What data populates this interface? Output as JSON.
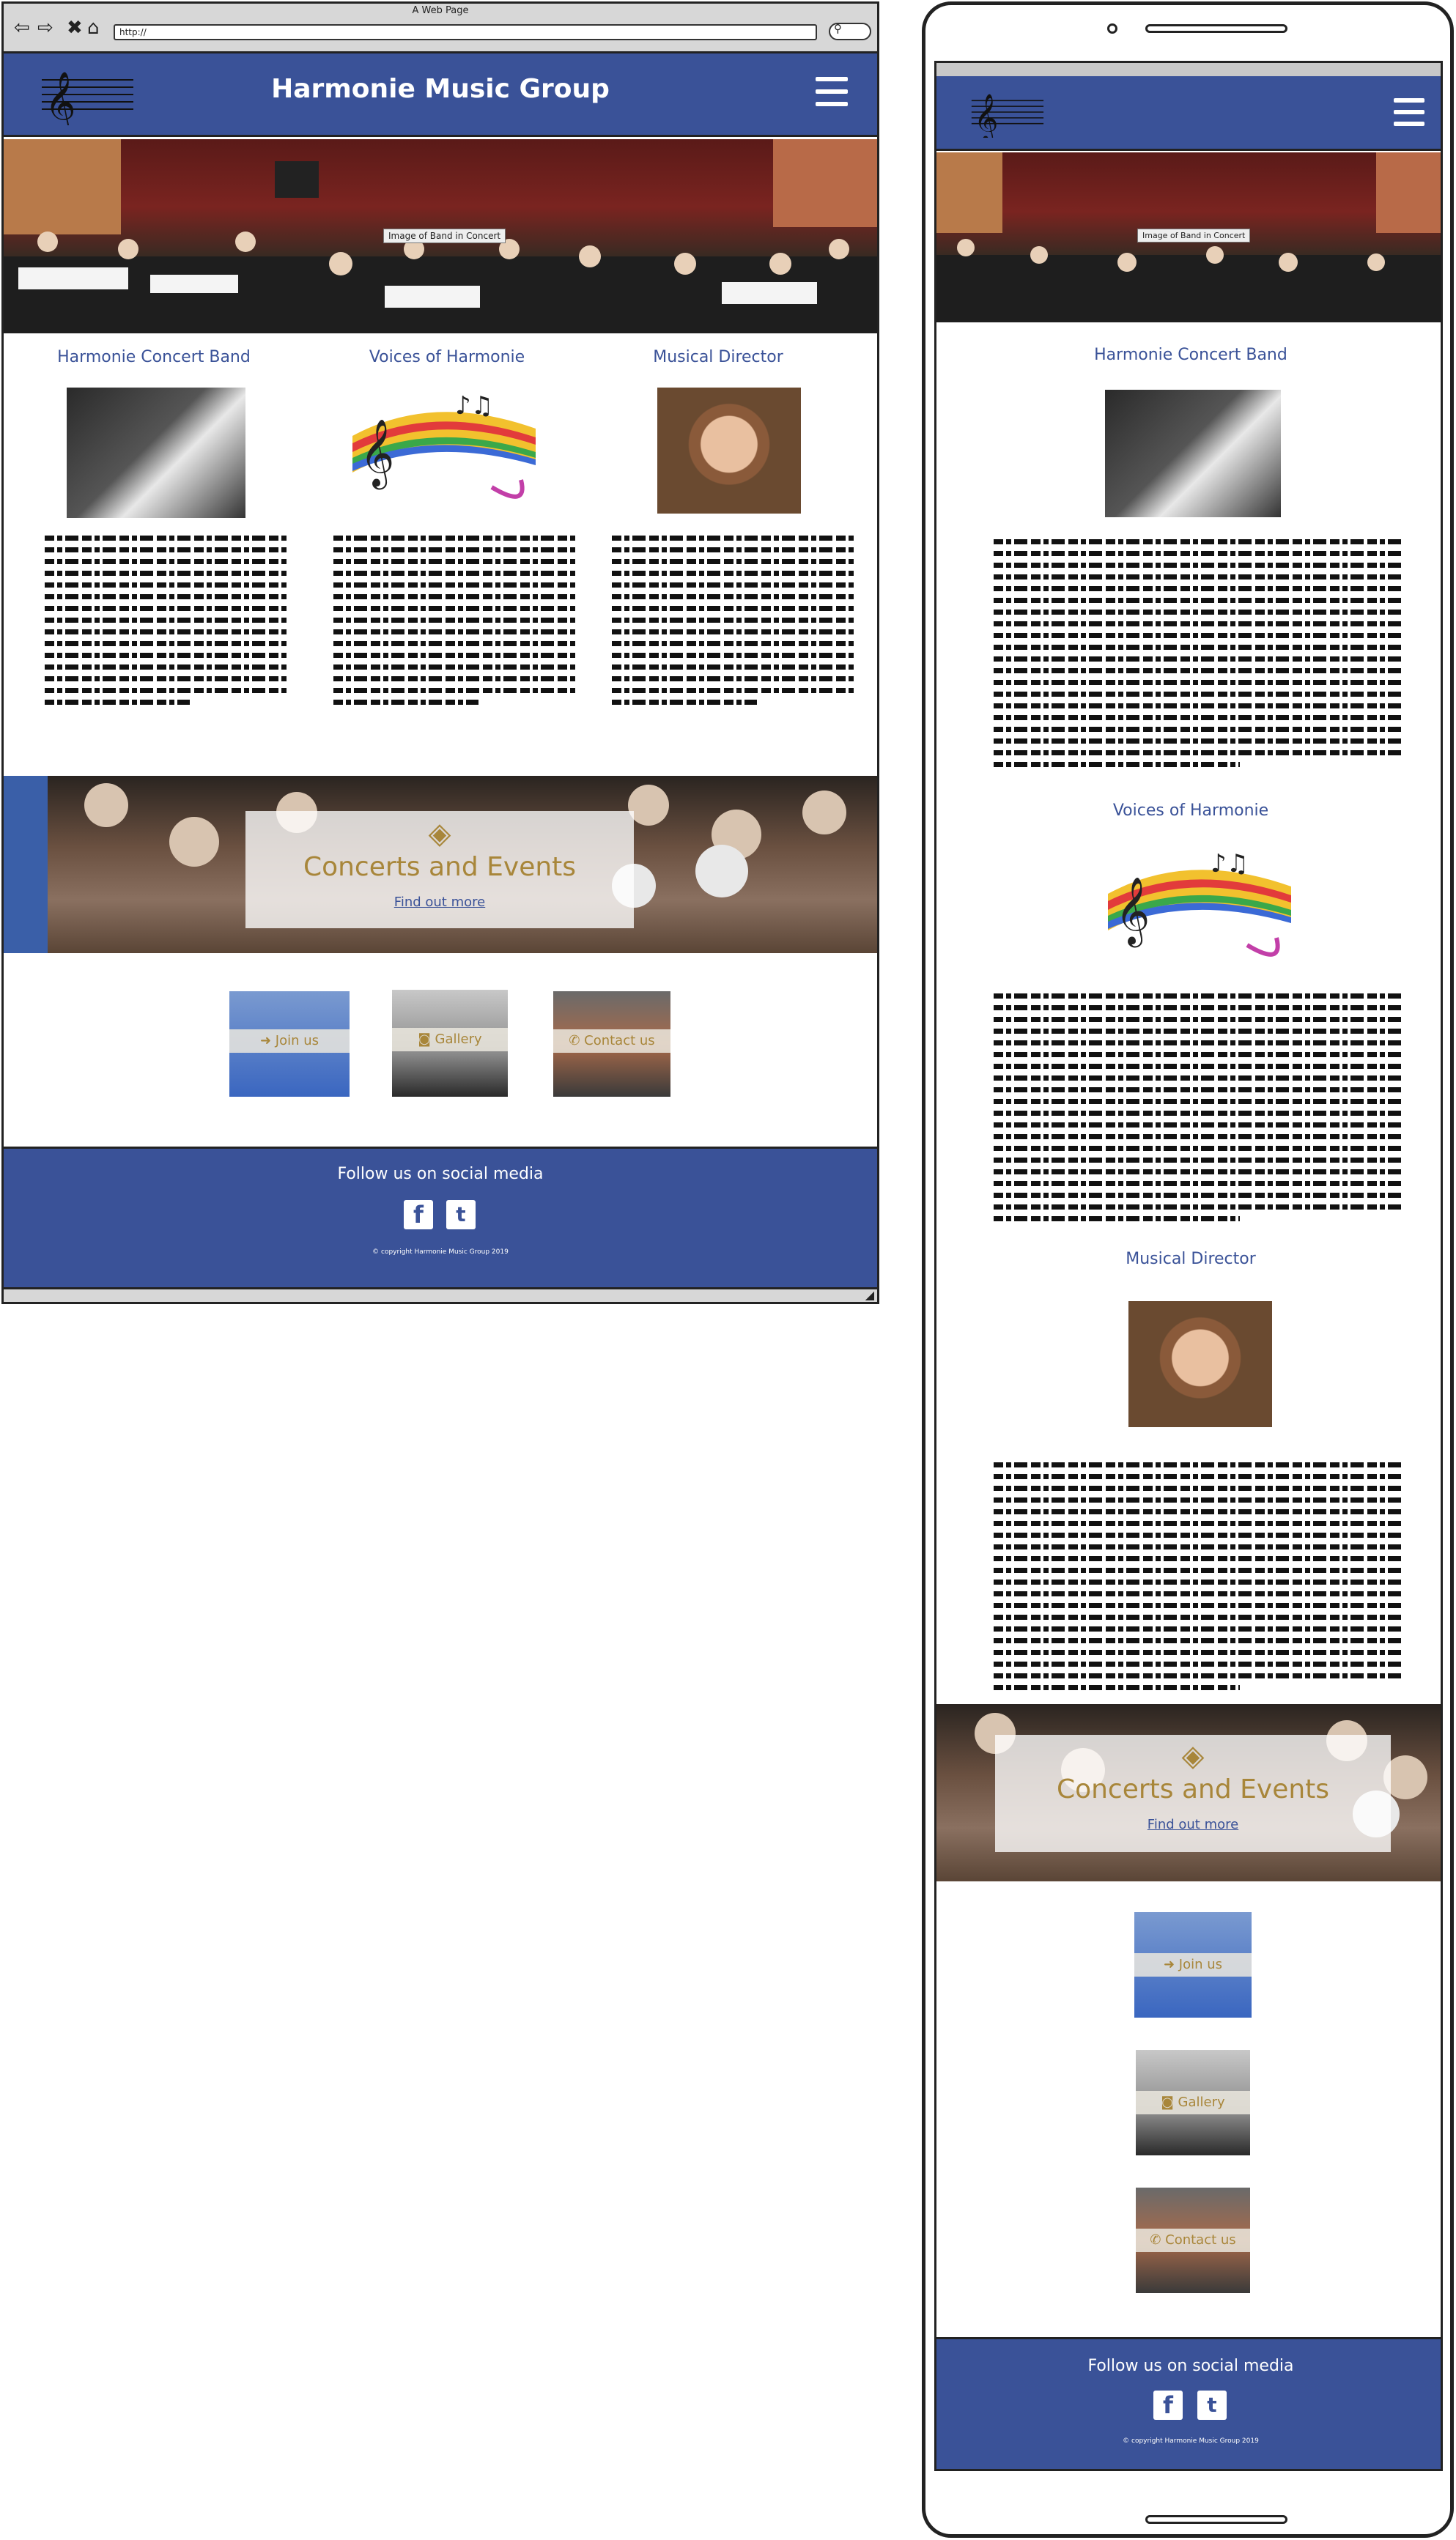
{
  "browser": {
    "window_title": "A Web Page",
    "url": "http://",
    "nav_icons": [
      "back-arrow-icon",
      "forward-arrow-icon",
      "close-x-icon",
      "home-icon"
    ],
    "resize_grip": "resize-grip-icon"
  },
  "site": {
    "title": "Harmonie Music Group",
    "logo_icon": "treble-clef-logo-icon",
    "menu_icon": "hamburger-menu-icon",
    "hero_caption": "Image of Band in Concert",
    "columns": [
      {
        "title": "Harmonie Concert Band",
        "image_icon": "concert-band-photo"
      },
      {
        "title": "Voices of Harmonie",
        "image_icon": "rainbow-music-notes-graphic"
      },
      {
        "title": "Musical Director",
        "image_icon": "director-portrait-photo"
      }
    ],
    "events": {
      "icon": "ticket-icon",
      "title": "Concerts and Events",
      "link": "Find out more"
    },
    "tiles": [
      {
        "label": "Join us",
        "icon": "sign-in-icon"
      },
      {
        "label": "Gallery",
        "icon": "camera-icon"
      },
      {
        "label": "Contact us",
        "icon": "phone-icon"
      }
    ],
    "footer": {
      "heading": "Follow us on social media",
      "facebook": "f",
      "twitter": "t",
      "social_icons": [
        "facebook-icon",
        "twitter-icon"
      ],
      "copyright": "© copyright Harmonie Music Group 2019"
    }
  },
  "colors": {
    "brand_blue": "#3a5298",
    "accent_gold": "#a8863a"
  }
}
